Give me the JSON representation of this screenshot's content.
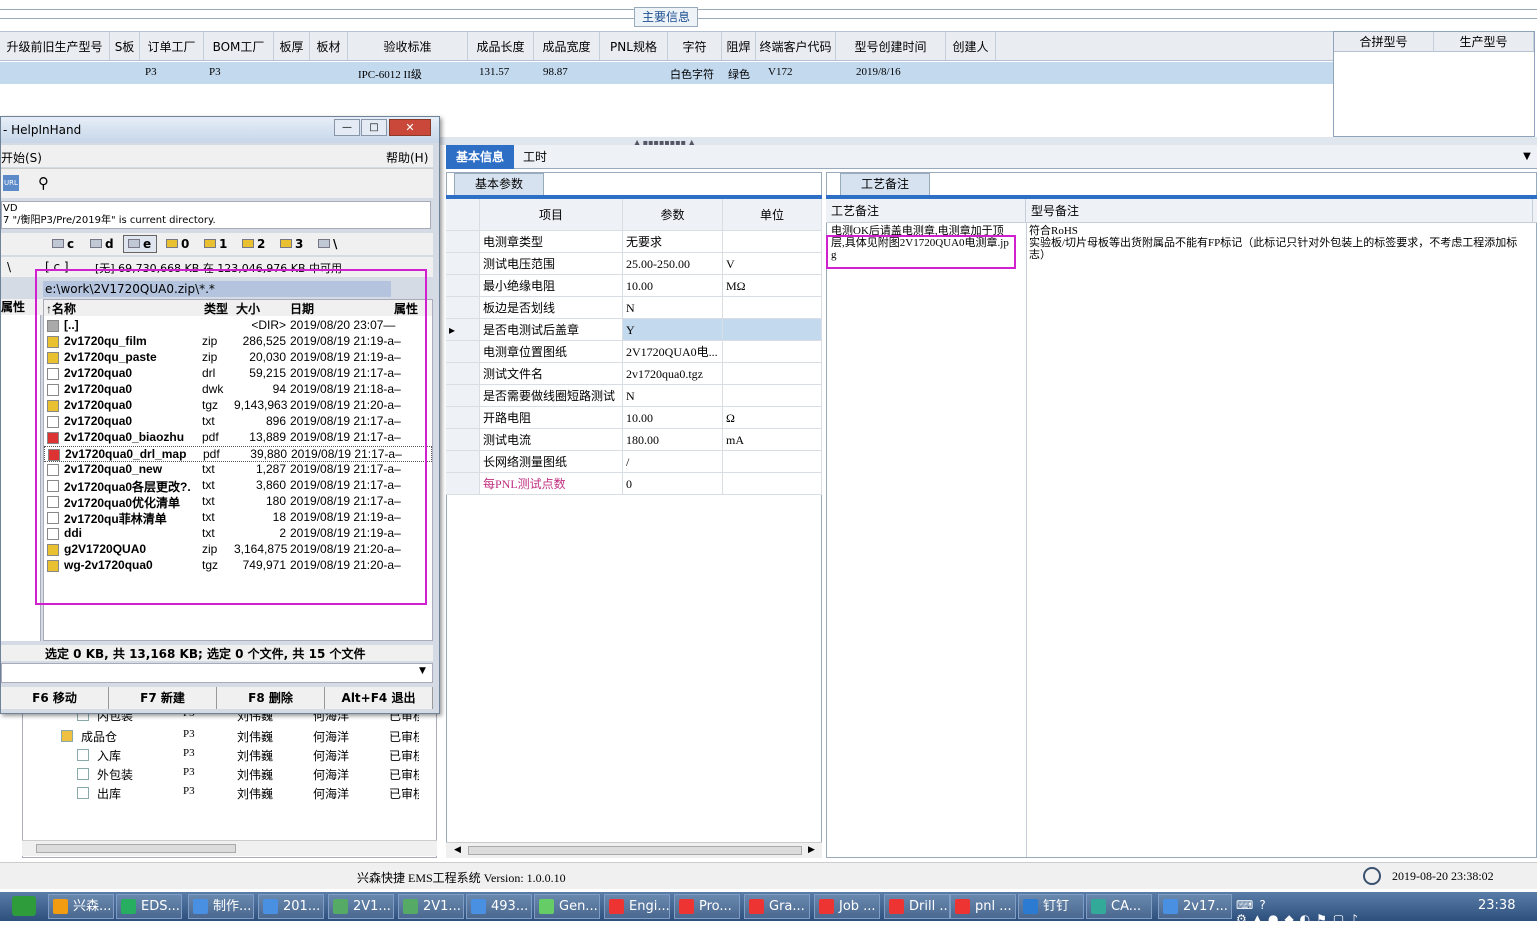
{
  "top": {
    "main_tab": "主要信息",
    "columns": [
      "升级前旧生产型号",
      "S板",
      "订单工厂",
      "BOM工厂",
      "板厚",
      "板材",
      "验收标准",
      "成品长度",
      "成品宽度",
      "PNL规格",
      "字符",
      "阻焊",
      "终端客户代码",
      "型号创建时间",
      "创建人"
    ],
    "row": {
      "s_board": "P3",
      "order_factory": "P3",
      "standard": "IPC-6012 II级",
      "length": "131.57",
      "width": "98.87",
      "char": "白色字符",
      "mask": "绿色",
      "customer": "V172",
      "created": "2019/8/16"
    },
    "right_cols": [
      "合拼型号",
      "生产型号"
    ]
  },
  "tabs": {
    "basic": "基本信息",
    "hours": "工时"
  },
  "params": {
    "tab": "基本参数",
    "headers": [
      "项目",
      "参数",
      "单位"
    ],
    "rows": [
      {
        "name": "电测章类型",
        "value": "无要求",
        "unit": ""
      },
      {
        "name": "测试电压范围",
        "value": "25.00-250.00",
        "unit": "V"
      },
      {
        "name": "最小绝缘电阻",
        "value": "10.00",
        "unit": "MΩ"
      },
      {
        "name": "板边是否划线",
        "value": "N",
        "unit": ""
      },
      {
        "name": "是否电测试后盖章",
        "value": "Y",
        "unit": ""
      },
      {
        "name": "电测章位置图纸",
        "value": "2V1720QUA0电...",
        "unit": ""
      },
      {
        "name": "测试文件名",
        "value": "2v1720qua0.tgz",
        "unit": ""
      },
      {
        "name": "是否需要做线圈短路测试",
        "value": "N",
        "unit": ""
      },
      {
        "name": "开路电阻",
        "value": "10.00",
        "unit": "Ω"
      },
      {
        "name": "测试电流",
        "value": "180.00",
        "unit": "mA"
      },
      {
        "name": "长网络测量图纸",
        "value": "/",
        "unit": ""
      },
      {
        "name": "每PNL测试点数",
        "value": "0",
        "unit": ""
      }
    ]
  },
  "remarks": {
    "tab": "工艺备注",
    "col1": "工艺备注",
    "col2": "型号备注",
    "process_note": "电测OK后请盖电测章,电测章加于顶层,具体见附图2V1720QUA0电测章.jpg",
    "model_note": "符合RoHS\n实验板/切片母板等出货附属品不能有FP标记（此标记只针对外包装上的标签要求，不考虑工程添加标志）"
  },
  "hih": {
    "title": "- HelpInHand",
    "menu_left": "开始(S)",
    "menu_right": "帮助(H)",
    "cmd_line1": "VD",
    "cmd_line2": "7 \"/衡阳P3/Pre/2019年\" is current directory.",
    "drives": [
      "c",
      "d",
      "e",
      "0",
      "1",
      "2",
      "3",
      "\\"
    ],
    "left_path": "[ c ] ",
    "info": "[无] 69,730,668 KB 在 123,046,976 KB 中可用",
    "path": "e:\\work\\2V1720QUA0.zip\\*.*",
    "left_attr": "属性",
    "columns": {
      "name": "↑名称",
      "type": "类型",
      "size": "大小",
      "date": "日期",
      "attr": "属性"
    },
    "files": [
      {
        "name": "[..]",
        "type": "",
        "size": "<DIR>",
        "date": "2019/08/20 23:07—",
        "icon": "up-icon"
      },
      {
        "name": "2v1720qu_film",
        "type": "zip",
        "size": "286,525",
        "date": "2019/08/19 21:19-a–",
        "icon": "zip-icon"
      },
      {
        "name": "2v1720qu_paste",
        "type": "zip",
        "size": "20,030",
        "date": "2019/08/19 21:19-a–",
        "icon": "zip-icon"
      },
      {
        "name": "2v1720qua0",
        "type": "drl",
        "size": "59,215",
        "date": "2019/08/19 21:17-a–",
        "icon": "file-icon"
      },
      {
        "name": "2v1720qua0",
        "type": "dwk",
        "size": "94",
        "date": "2019/08/19 21:18-a–",
        "icon": "file-icon"
      },
      {
        "name": "2v1720qua0",
        "type": "tgz",
        "size": "9,143,963",
        "date": "2019/08/19 21:20-a–",
        "icon": "zip-icon"
      },
      {
        "name": "2v1720qua0",
        "type": "txt",
        "size": "896",
        "date": "2019/08/19 21:17-a–",
        "icon": "text-icon"
      },
      {
        "name": "2v1720qua0_biaozhu",
        "type": "pdf",
        "size": "13,889",
        "date": "2019/08/19 21:17-a–",
        "icon": "pdf-icon"
      },
      {
        "name": "2v1720qua0_drl_map",
        "type": "pdf",
        "size": "39,880",
        "date": "2019/08/19 21:17-a–",
        "icon": "pdf-icon"
      },
      {
        "name": "2v1720qua0_new",
        "type": "txt",
        "size": "1,287",
        "date": "2019/08/19 21:17-a–",
        "icon": "text-icon"
      },
      {
        "name": "2v1720qua0各层更改?.",
        "type": "txt",
        "size": "3,860",
        "date": "2019/08/19 21:17-a–",
        "icon": "text-icon"
      },
      {
        "name": "2v1720qua0优化清单",
        "type": "txt",
        "size": "180",
        "date": "2019/08/19 21:17-a–",
        "icon": "text-icon"
      },
      {
        "name": "2v1720qu菲林清单",
        "type": "txt",
        "size": "18",
        "date": "2019/08/19 21:19-a–",
        "icon": "text-icon"
      },
      {
        "name": "ddi",
        "type": "txt",
        "size": "2",
        "date": "2019/08/19 21:19-a–",
        "icon": "text-icon"
      },
      {
        "name": "g2V1720QUA0",
        "type": "zip",
        "size": "3,164,875",
        "date": "2019/08/19 21:20-a–",
        "icon": "zip-icon"
      },
      {
        "name": "wg-2v1720qua0",
        "type": "tgz",
        "size": "749,971",
        "date": "2019/08/19 21:20-a–",
        "icon": "zip-icon"
      }
    ],
    "status": "选定 0 KB, 共 13,168 KB; 选定 0 个文件, 共 15 个文件",
    "fkeys": [
      "F6 移动",
      "F7 新建",
      "F8 删除",
      "Alt+F4 退出"
    ]
  },
  "tree": {
    "rows": [
      {
        "label": "内包装",
        "c1": "P3",
        "c2": "刘伟巍",
        "c3": "何海洋",
        "c4": "已审核"
      },
      {
        "label": "成品仓",
        "c1": "P3",
        "c2": "刘伟巍",
        "c3": "何海洋",
        "c4": "已审核"
      },
      {
        "label": "入库",
        "c1": "P3",
        "c2": "刘伟巍",
        "c3": "何海洋",
        "c4": "已审核"
      },
      {
        "label": "外包装",
        "c1": "P3",
        "c2": "刘伟巍",
        "c3": "何海洋",
        "c4": "已审核"
      },
      {
        "label": "出库",
        "c1": "P3",
        "c2": "刘伟巍",
        "c3": "何海洋",
        "c4": "已审核"
      }
    ]
  },
  "status": {
    "app": "兴森快捷 EMS工程系统 Version: 1.0.0.10",
    "datetime": "2019-08-20 23:38:02"
  },
  "taskbar": {
    "items": [
      "兴森...",
      "EDS...",
      "制作...",
      "201...",
      "2V1...",
      "2V1...",
      "493...",
      "Gen...",
      "Engi...",
      "Pro...",
      "Gra...",
      "Job ...",
      "Drill ...",
      "pnl ...",
      "钉钉",
      "CA...",
      "2v17..."
    ],
    "clock": "23:38"
  },
  "colors": {
    "highlight": "#c3d9ee",
    "accent": "#2e6fc6",
    "annotation": "#d020d0"
  }
}
